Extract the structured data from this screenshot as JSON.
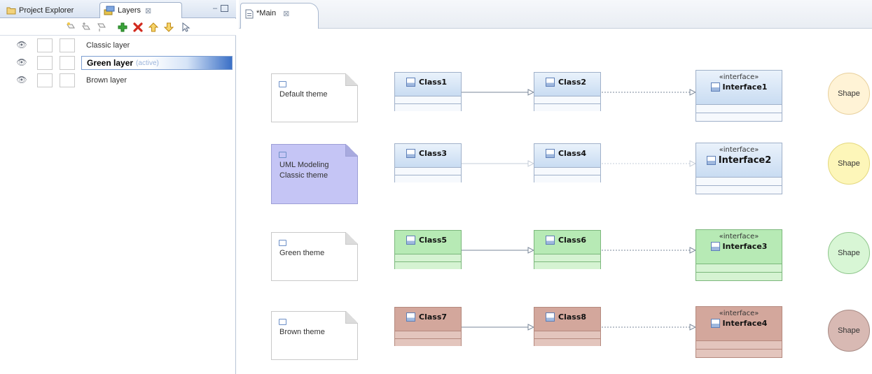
{
  "left_view": {
    "tabs": [
      {
        "label": "Project Explorer"
      },
      {
        "label": "Layers",
        "close": "⊠"
      }
    ],
    "view_controls": {
      "minimize": "–",
      "maximize": "□"
    },
    "toolbar_icons": [
      "new-layer-icon",
      "new-layer-above-icon",
      "new-layer-below-icon",
      "add-icon",
      "delete-icon",
      "move-up-icon",
      "move-down-icon",
      "select-icon"
    ],
    "colors": {
      "add": "#3aa33a",
      "delete": "#d22a1e",
      "move": "#e0a418",
      "select": "#5a6b85"
    },
    "layers": [
      {
        "name": "Classic layer",
        "active": false
      },
      {
        "name": "Green layer",
        "active": true,
        "tag": "(active)"
      },
      {
        "name": "Brown layer",
        "active": false
      }
    ]
  },
  "editor": {
    "tab": {
      "label": "*Main",
      "close": "⊠"
    },
    "rows": [
      {
        "note": "Default theme",
        "classes": [
          "Class1",
          "Class2"
        ],
        "interface": {
          "stereotype": "«interface»",
          "name": "Interface1"
        },
        "shape": "Shape"
      },
      {
        "note": "UML Modeling Classic theme",
        "classes": [
          "Class3",
          "Class4"
        ],
        "interface": {
          "stereotype": "«interface»",
          "name": "Interface2"
        },
        "shape": "Shape"
      },
      {
        "note": "Green theme",
        "classes": [
          "Class5",
          "Class6"
        ],
        "interface": {
          "stereotype": "«interface»",
          "name": "Interface3"
        },
        "shape": "Shape"
      },
      {
        "note": "Brown theme",
        "classes": [
          "Class7",
          "Class8"
        ],
        "interface": {
          "stereotype": "«interface»",
          "name": "Interface4"
        },
        "shape": "Shape"
      }
    ]
  }
}
